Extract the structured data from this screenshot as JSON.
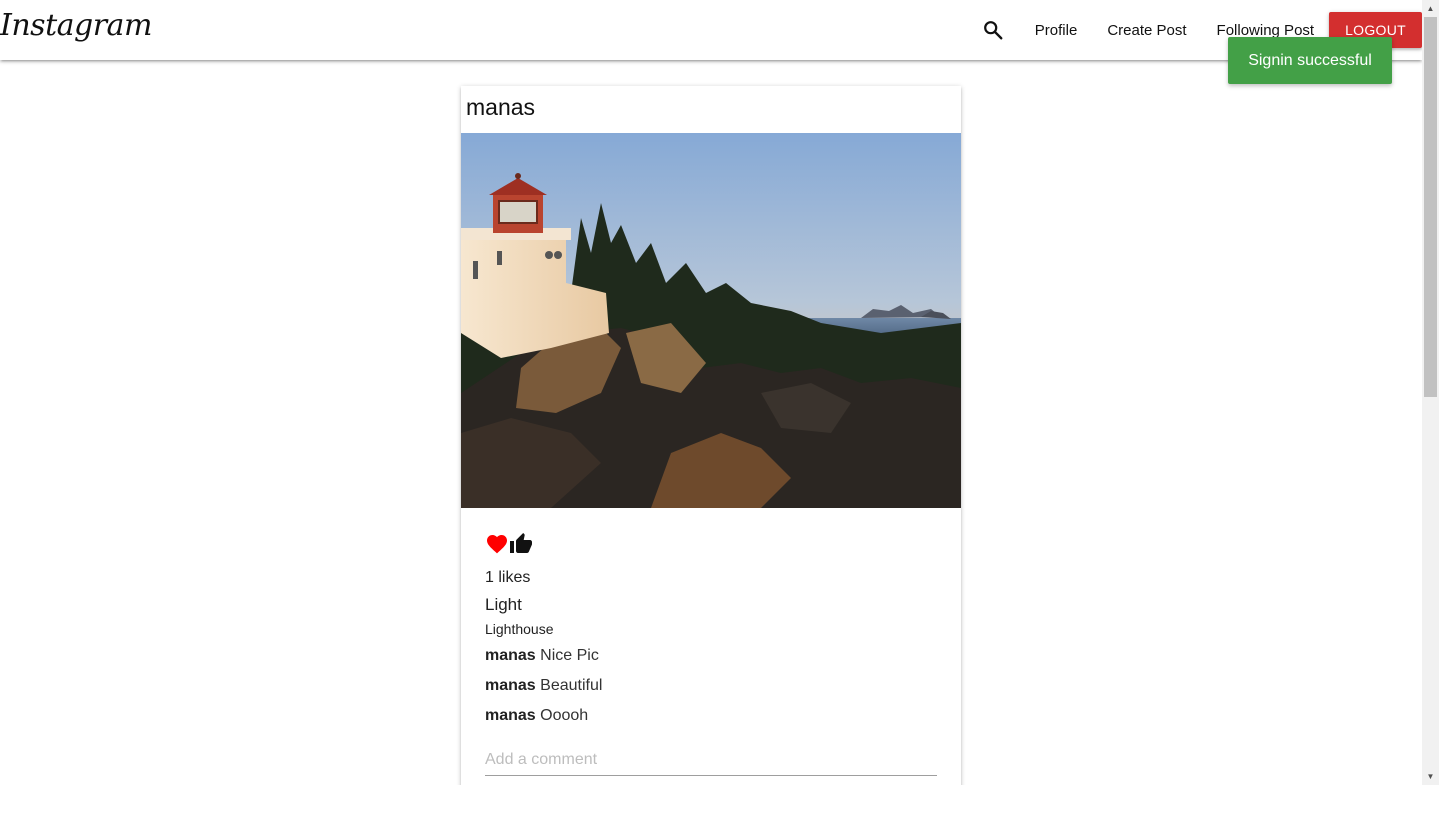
{
  "navbar": {
    "brand": "Instagram",
    "search_icon": "search-icon",
    "links": [
      "Profile",
      "Create Post",
      "Following Post"
    ],
    "logout_label": "LOGOUT",
    "logout_color": "#d32f2f"
  },
  "toast": {
    "message": "Signin successful",
    "color": "#43a047"
  },
  "post": {
    "author": "manas",
    "image_alt": "Lighthouse",
    "icons": [
      "heart-icon",
      "thumbs-up-icon"
    ],
    "heart_color": "#ff0000",
    "likes": "1 likes",
    "title": "Light",
    "body": "Lighthouse",
    "comments": [
      {
        "user": "manas",
        "text": " Nice Pic"
      },
      {
        "user": "manas",
        "text": " Beautiful"
      },
      {
        "user": "manas",
        "text": " Ooooh"
      }
    ],
    "comment_placeholder": "Add a comment"
  }
}
